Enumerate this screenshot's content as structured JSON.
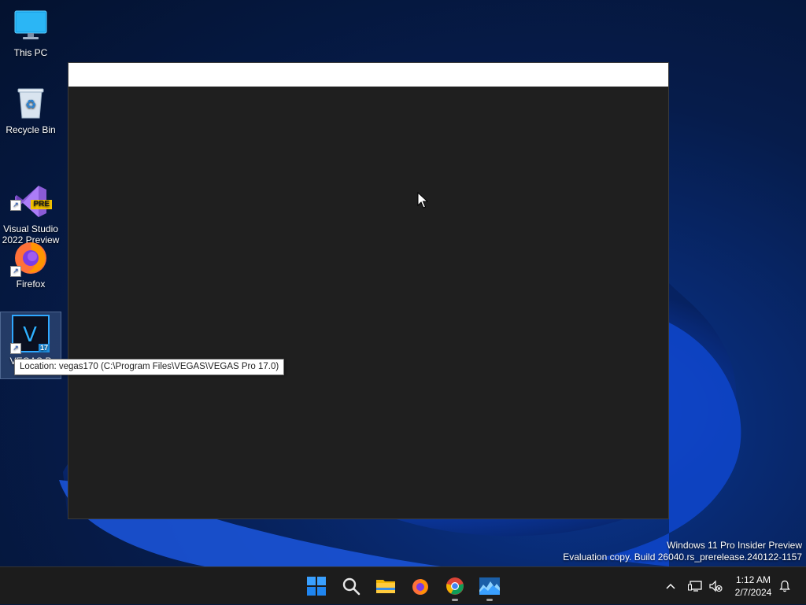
{
  "desktop": {
    "icons": [
      {
        "label": "This PC",
        "icon": "monitor-icon"
      },
      {
        "label": "Recycle Bin",
        "icon": "recycle-bin-icon"
      },
      {
        "label": "Visual Studio\n2022 Preview",
        "icon": "visual-studio-icon",
        "badge": "PRE"
      },
      {
        "label": "Firefox",
        "icon": "firefox-icon"
      },
      {
        "label": "VEGAS P",
        "icon": "vegas-pro-icon",
        "badge": "17",
        "selected": true
      }
    ],
    "tooltip": "Location: vegas170 (C:\\Program Files\\VEGAS\\VEGAS Pro 17.0)",
    "watermark": {
      "line1": "Windows 11 Pro Insider Preview",
      "line2": "Evaluation copy. Build 26040.rs_prerelease.240122-1157"
    }
  },
  "window": {
    "title": ""
  },
  "taskbar": {
    "apps": [
      {
        "name": "Start",
        "icon": "windows-start-icon"
      },
      {
        "name": "Search",
        "icon": "search-icon"
      },
      {
        "name": "File Explorer",
        "icon": "folder-icon"
      },
      {
        "name": "Firefox",
        "icon": "firefox-icon"
      },
      {
        "name": "Chrome",
        "icon": "chrome-icon",
        "running": true
      },
      {
        "name": "VEGAS Pro",
        "icon": "vegas-app-icon",
        "running": true
      }
    ],
    "tray": {
      "icons": [
        "chevron-up-icon",
        "network-icon",
        "volume-muted-icon",
        "notification-bell-icon"
      ],
      "time": "1:12 AM",
      "date": "2/7/2024"
    }
  },
  "colors": {
    "accent": "#0078d4",
    "taskbar": "#1c1c1c",
    "window_body": "#1f1f1f"
  }
}
